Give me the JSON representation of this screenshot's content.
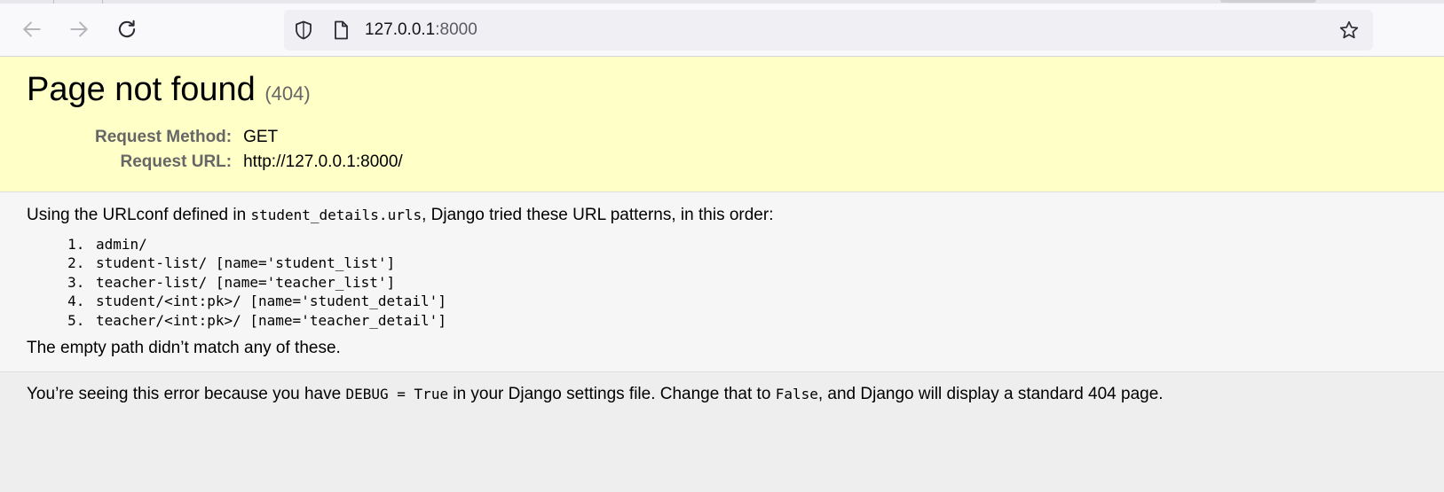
{
  "browser": {
    "url_host": "127.0.0.1",
    "url_port": ":8000",
    "icons": {
      "back": "arrow-left-icon",
      "forward": "arrow-right-icon",
      "reload": "reload-icon",
      "tracking": "shield-icon",
      "page": "page-icon",
      "bookmark": "star-icon"
    }
  },
  "summary": {
    "title": "Page not found",
    "status_code": "(404)",
    "rows": [
      {
        "label": "Request Method:",
        "value": "GET"
      },
      {
        "label": "Request URL:",
        "value": "http://127.0.0.1:8000/"
      }
    ]
  },
  "info": {
    "intro_before": "Using the URLconf defined in ",
    "intro_code": "student_details.urls",
    "intro_after": ", Django tried these URL patterns, in this order:",
    "patterns": [
      "admin/",
      "student-list/ [name='student_list']",
      "teacher-list/ [name='teacher_list']",
      "student/<int:pk>/ [name='student_detail']",
      "teacher/<int:pk>/ [name='teacher_detail']"
    ],
    "no_match": "The empty path didn’t match any of these."
  },
  "explanation": {
    "part1": "You’re seeing this error because you have ",
    "code1": "DEBUG = True",
    "part2": " in your Django settings file. Change that to ",
    "code2": "False",
    "part3": ", and Django will display a standard 404 page."
  },
  "colors": {
    "summary_bg": "#ffffc8",
    "info_bg": "#f6f6f6",
    "explanation_bg": "#eeeeee",
    "label_gray": "#666666"
  }
}
